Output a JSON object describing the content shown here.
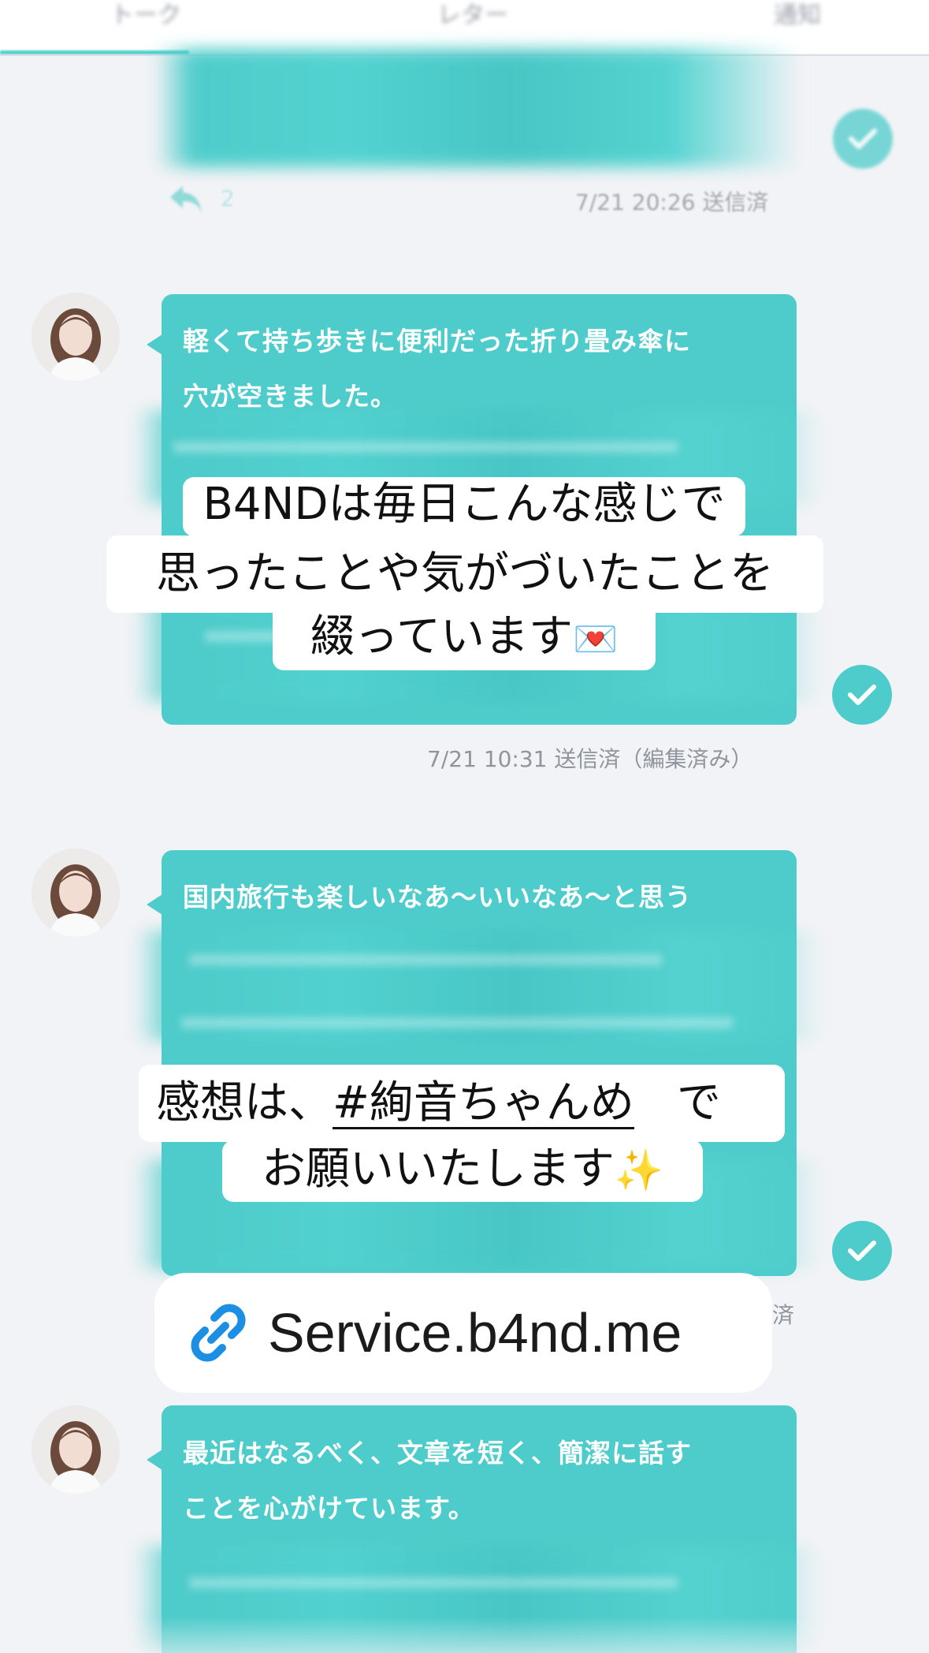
{
  "tabs": [
    {
      "label": "トーク"
    },
    {
      "label": "レター"
    },
    {
      "label": "通知"
    }
  ],
  "messages": [
    {
      "text_lines": [],
      "reply_count": "2",
      "meta": "7/21 20:26 送信済"
    },
    {
      "text_lines": [
        "軽くて持ち歩きに便利だった折り畳み傘に",
        "穴が空きました。"
      ],
      "meta": "7/21 10:31 送信済（編集済み）"
    },
    {
      "text_lines": [
        "国内旅行も楽しいなあ〜いいなあ〜と思う"
      ],
      "meta": "済"
    },
    {
      "text_lines": [
        "最近はなるべく、文章を短く、簡潔に話す",
        "ことを心がけています。"
      ]
    }
  ],
  "captions": {
    "first": [
      "B4NDは毎日こんな感じで",
      "思ったことや気がづいたことを",
      "綴っています"
    ],
    "first_emoji": "💌",
    "second_line1_prefix": "感想は、",
    "second_hashtag": "#絢音ちゃんめ",
    "second_line1_suffix": "で",
    "second_line2": "お願いいたします",
    "second_emoji": "✨"
  },
  "link": {
    "text": "Service.b4nd.me"
  },
  "colors": {
    "bubble": "#4ecccb",
    "background": "#f2f3f6",
    "link_icon": "#1a8fe3"
  },
  "icons": [
    "reply-icon",
    "check-icon",
    "link-icon"
  ]
}
